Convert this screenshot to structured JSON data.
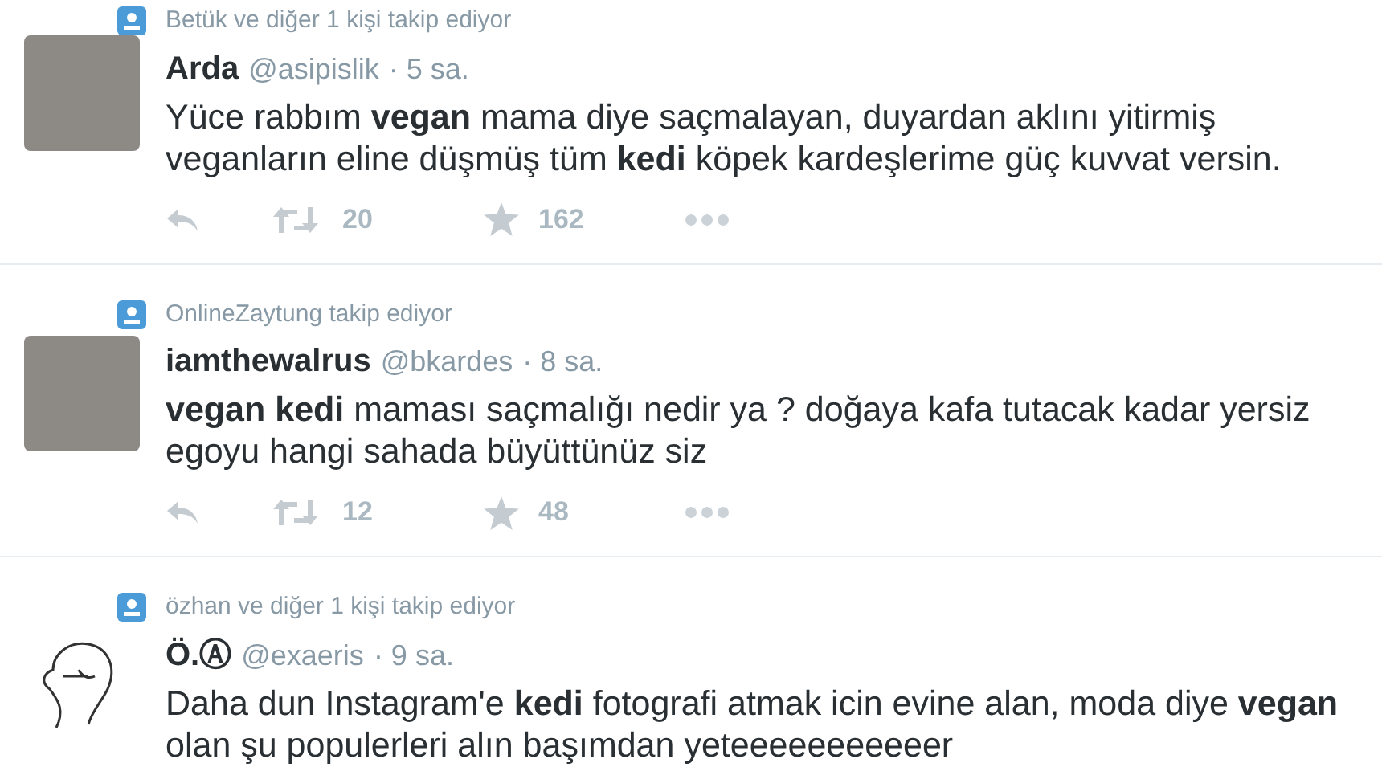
{
  "tweets": [
    {
      "social_context": "Betük ve diğer 1 kişi takip ediyor",
      "kind": "photo",
      "name": "Arda",
      "handle": "@asipislik",
      "time": "· 5 sa.",
      "text": "Yüce rabbım **vegan** mama diye saçmalayan, duyardan aklını yitirmiş veganların eline düşmüş tüm **kedi** köpek kardeşlerime güç kuvvat versin.",
      "retweets": "20",
      "favorites": "162"
    },
    {
      "social_context": "OnlineZaytung takip ediyor",
      "kind": "photo",
      "name": "iamthewalrus",
      "handle": "@bkardes",
      "time": "· 8 sa.",
      "text": "**vegan kedi** maması saçmalığı nedir ya ? doğaya kafa tutacak kadar yersiz egoyu hangi sahada büyüttünüz siz",
      "retweets": "12",
      "favorites": "48"
    },
    {
      "social_context": "özhan ve diğer 1 kişi takip ediyor",
      "kind": "sketch",
      "name": "Ö.Ⓐ",
      "handle": "@exaeris",
      "time": "· 9 sa.",
      "text": "Daha dun Instagram'e **kedi** fotografi atmak icin evine alan, moda diye **vegan** olan şu populerleri alın başımdan yeteeeeeeeeeeer"
    }
  ]
}
